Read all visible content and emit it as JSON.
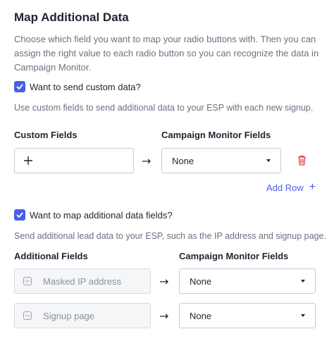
{
  "section": {
    "title": "Map Additional Data",
    "description": "Choose which field you want to map your radio buttons with. Then you can assign the right value to each radio button so you can recognize the data in Campaign Monitor."
  },
  "custom": {
    "checkbox_label": "Want to send custom data?",
    "checked": true,
    "hint": "Use custom fields to send additional data to your ESP with each new signup.",
    "col_left": "Custom Fields",
    "col_right": "Campaign Monitor Fields",
    "select_value": "None",
    "add_row_label": "Add Row",
    "add_row_plus": "+"
  },
  "additional": {
    "checkbox_label": "Want to map additional data fields?",
    "checked": true,
    "hint": "Send additional lead data to your ESP, such as the IP address and signup page.",
    "col_left": "Additional Fields",
    "col_right": "Campaign Monitor Fields",
    "rows": [
      {
        "field": "Masked IP address",
        "value": "None"
      },
      {
        "field": "Signup page",
        "value": "None"
      }
    ]
  },
  "icons": {
    "arrow": "→",
    "chip": "<>",
    "colors": {
      "accent": "#4a5ee8",
      "danger": "#e0393e"
    }
  }
}
